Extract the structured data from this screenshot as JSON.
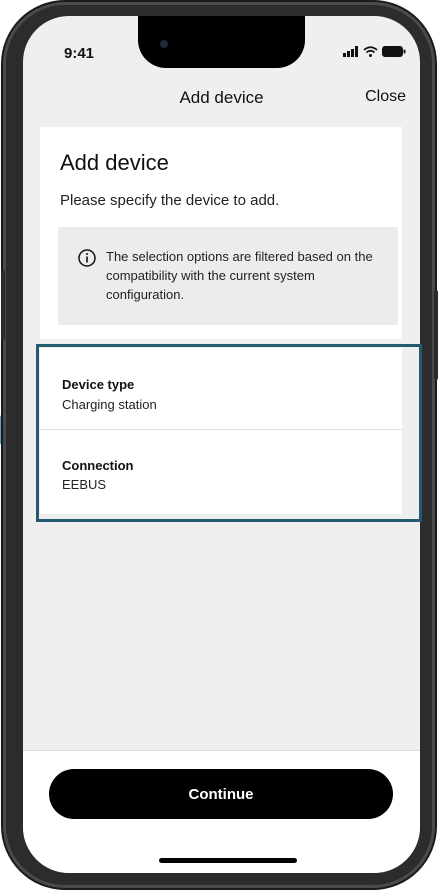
{
  "status_bar": {
    "time": "9:41"
  },
  "nav": {
    "title": "Add device",
    "close_label": "Close"
  },
  "main": {
    "heading": "Add device",
    "subtitle": "Please specify the device to add.",
    "info": {
      "icon": "info-icon",
      "text": "The selection options are filtered based on the compatibility with the current system configuration."
    }
  },
  "fields": [
    {
      "label": "Device type",
      "value": "Charging station"
    },
    {
      "label": "Connection",
      "value": "EEBUS"
    }
  ],
  "footer": {
    "continue_label": "Continue"
  },
  "colors": {
    "highlight": "#245a70",
    "button": "#000000",
    "background": "#efefef"
  }
}
